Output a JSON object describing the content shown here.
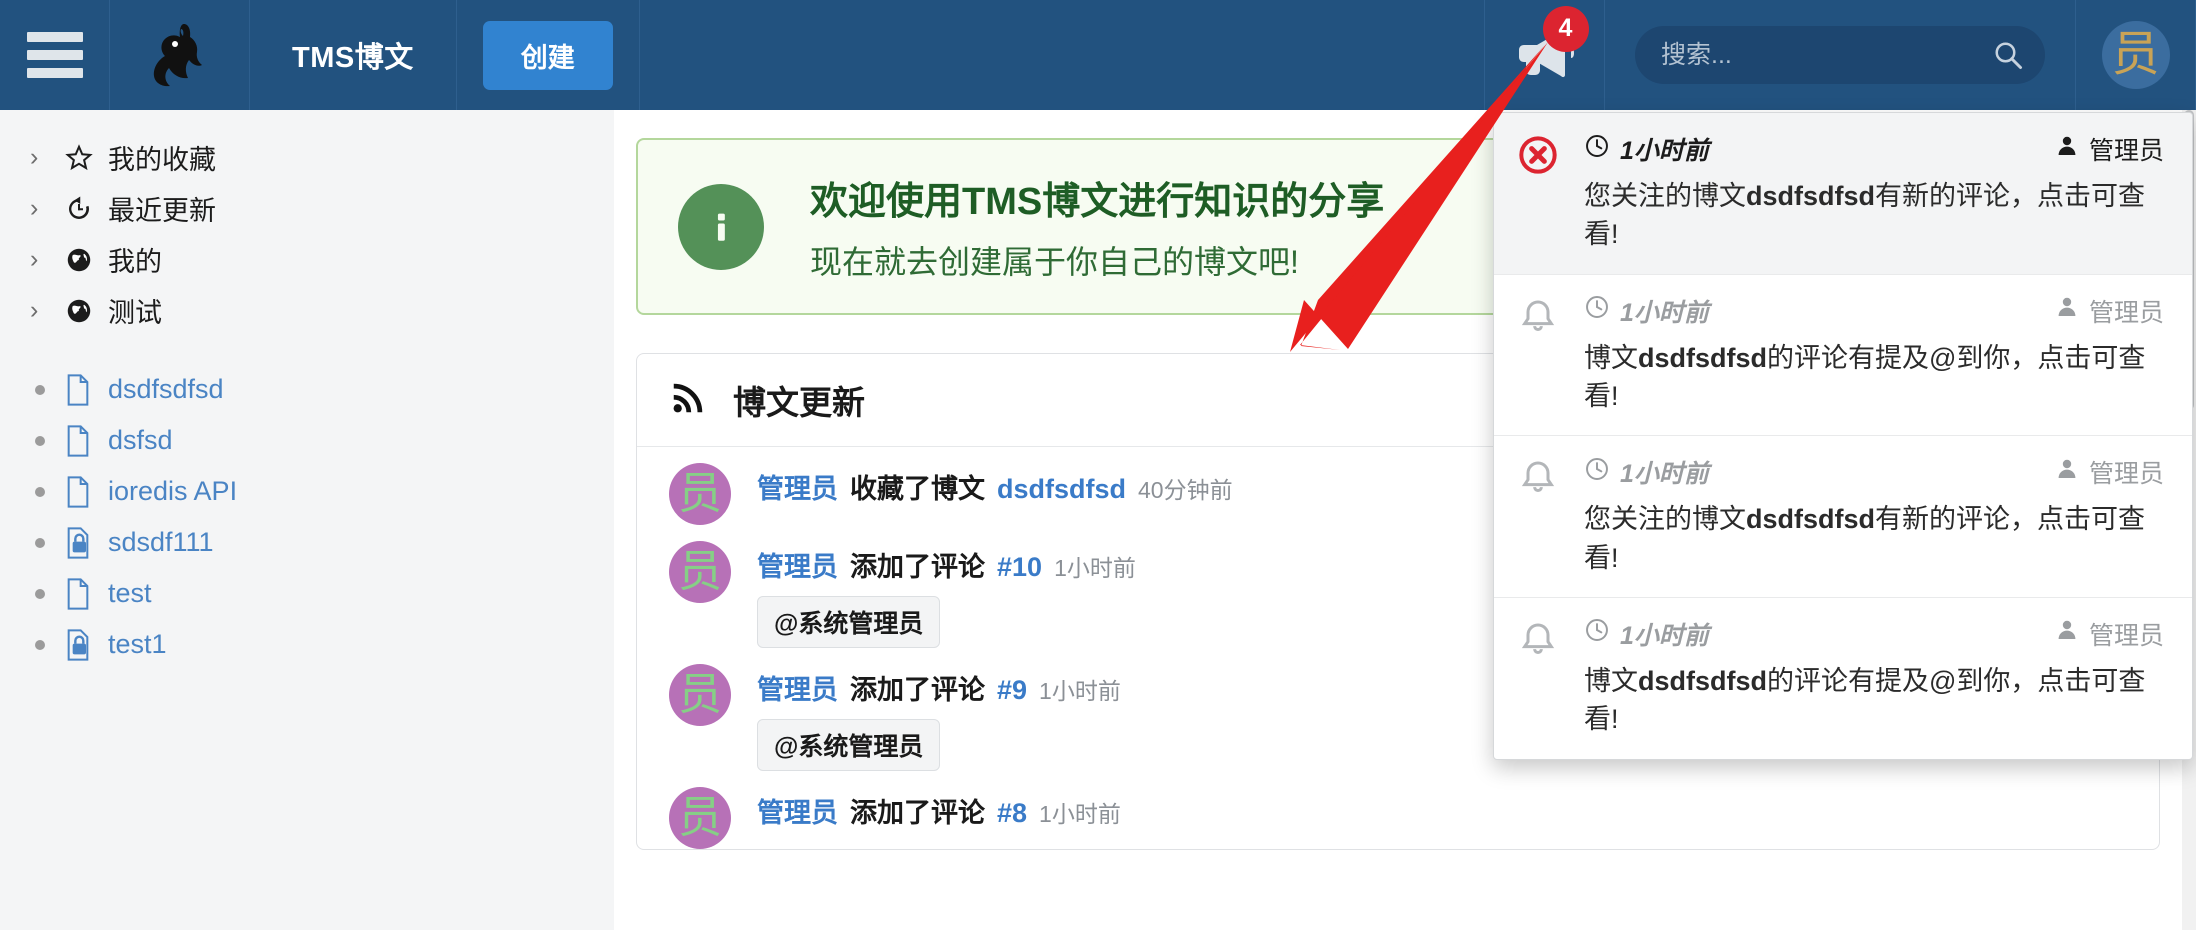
{
  "header": {
    "menu_icon": "hamburger-icon",
    "logo_icon": "rabbit-logo",
    "title": "TMS博文",
    "create_label": "创建",
    "notification_icon": "megaphone-icon",
    "notification_count": "4",
    "search_placeholder": "搜索...",
    "search_value": "",
    "search_icon": "search-icon",
    "avatar_text": "员",
    "accent_color": "#3183d0",
    "header_bg": "#22527f",
    "badge_color": "#dc2430"
  },
  "sidebar": {
    "groups": [
      {
        "label": "我的收藏",
        "icon": "star-icon",
        "chevron": "›"
      },
      {
        "label": "最近更新",
        "icon": "history-icon",
        "chevron": "›"
      },
      {
        "label": "我的",
        "icon": "globe-icon",
        "chevron": "›"
      },
      {
        "label": "测试",
        "icon": "globe-icon",
        "chevron": "›"
      }
    ],
    "documents": [
      {
        "label": "dsdfsdfsd",
        "icon": "file-icon",
        "locked": false
      },
      {
        "label": "dsfsd",
        "icon": "file-icon",
        "locked": false
      },
      {
        "label": "ioredis API",
        "icon": "file-icon",
        "locked": false
      },
      {
        "label": "sdsdf111",
        "icon": "file-lock-icon",
        "locked": true
      },
      {
        "label": "test",
        "icon": "file-icon",
        "locked": false
      },
      {
        "label": "test1",
        "icon": "file-lock-icon",
        "locked": true
      }
    ]
  },
  "banner": {
    "icon": "info-circle-icon",
    "title": "欢迎使用TMS博文进行知识的分享",
    "subtitle": "现在就去创建属于你自己的博文吧!",
    "border_color": "#b4d79c",
    "bg_color": "#f7fcf2",
    "text_color": "#1e5d25"
  },
  "feed": {
    "icon": "rss-icon",
    "title": "博文更新",
    "items": [
      {
        "avatar_text": "员",
        "user": "管理员",
        "action": "收藏了博文",
        "target": "dsdfsdfsd",
        "time": "40分钟前",
        "mention": ""
      },
      {
        "avatar_text": "员",
        "user": "管理员",
        "action": "添加了评论",
        "target": "#10",
        "time": "1小时前",
        "mention": "@系统管理员"
      },
      {
        "avatar_text": "员",
        "user": "管理员",
        "action": "添加了评论",
        "target": "#9",
        "time": "1小时前",
        "mention": "@系统管理员"
      },
      {
        "avatar_text": "员",
        "user": "管理员",
        "action": "添加了评论",
        "target": "#8",
        "time": "1小时前",
        "mention": ""
      }
    ]
  },
  "notifications": {
    "items": [
      {
        "icon": "remove-circle-icon",
        "state": "unread",
        "time": "1小时前",
        "user": "管理员",
        "text_before": "您关注的博文",
        "text_bold": "dsdfsdfsd",
        "text_after": "有新的评论，点击可查看!"
      },
      {
        "icon": "bell-icon",
        "state": "read",
        "time": "1小时前",
        "user": "管理员",
        "text_before": "博文",
        "text_bold": "dsdfsdfsd",
        "text_after": "的评论有提及@到你，点击可查看!"
      },
      {
        "icon": "bell-icon",
        "state": "read",
        "time": "1小时前",
        "user": "管理员",
        "text_before": "您关注的博文",
        "text_bold": "dsdfsdfsd",
        "text_after": "有新的评论，点击可查看!"
      },
      {
        "icon": "bell-icon",
        "state": "read",
        "time": "1小时前",
        "user": "管理员",
        "text_before": "博文",
        "text_bold": "dsdfsdfsd",
        "text_after": "的评论有提及@到你，点击可查看!"
      }
    ]
  },
  "annotation": {
    "arrow_color": "#e8201e",
    "arrow_name": "red-pointer-arrow"
  }
}
